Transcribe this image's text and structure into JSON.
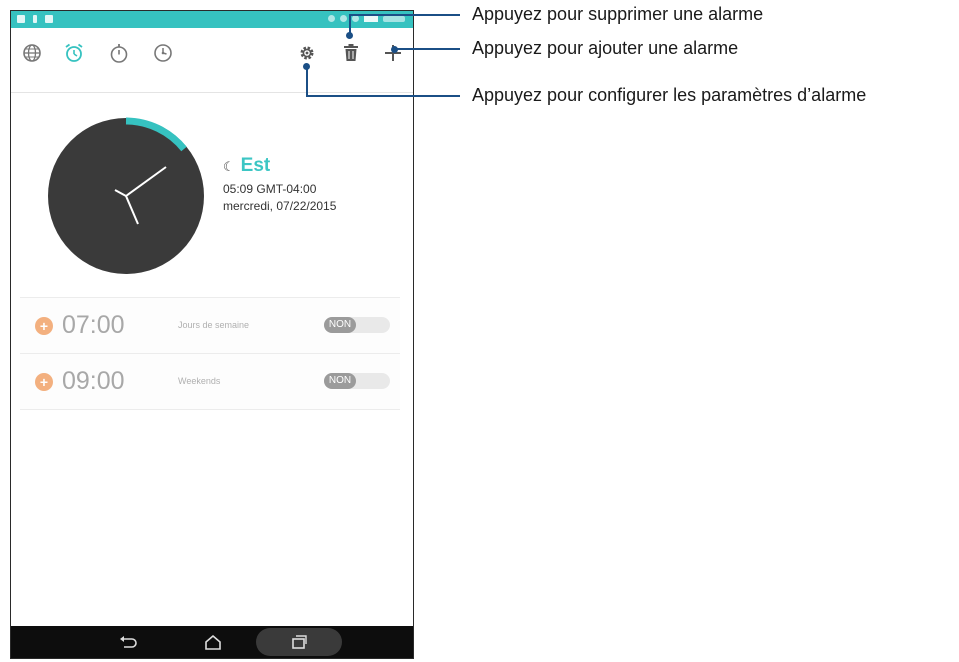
{
  "toolbar": {
    "icons": [
      "world-clock-icon",
      "alarm-icon",
      "stopwatch-icon",
      "timer-icon",
      "settings-icon",
      "delete-icon",
      "add-icon"
    ]
  },
  "clock": {
    "moon_icon": "☾",
    "city": "Est",
    "time_line": "05:09  GMT-04:00",
    "date_line": "mercredi, 07/22/2015"
  },
  "alarms": [
    {
      "time": "07:00",
      "days": "Jours de semaine",
      "toggle": "NON"
    },
    {
      "time": "09:00",
      "days": "Weekends",
      "toggle": "NON"
    }
  ],
  "callouts": {
    "delete": "Appuyez pour supprimer une alarme",
    "add": "Appuyez pour ajouter une alarme",
    "settings": "Appuyez pour configurer les paramètres d’alarme"
  },
  "colors": {
    "accent": "#36c2c0",
    "alarm_dot": "#f3b07f",
    "callout": "#1b4f86",
    "clock_face": "#3a3a3a"
  }
}
